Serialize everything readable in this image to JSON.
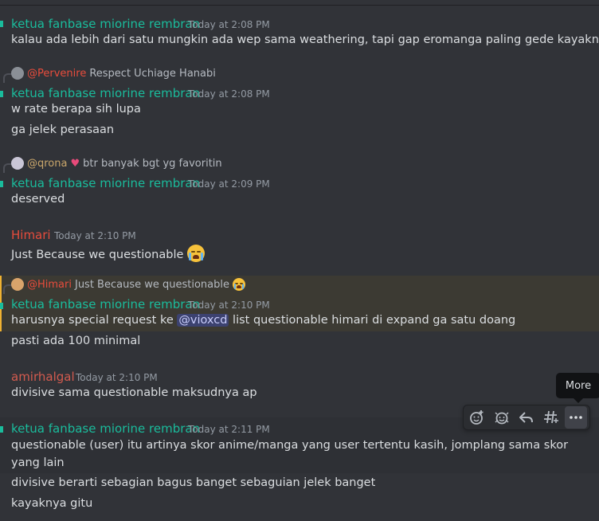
{
  "colors": {
    "background": "#313338",
    "name_teal": "#1abc9c",
    "name_red": "#e74c3c",
    "name_amir": "#d35b4f",
    "mention_highlight": "#3c3a33",
    "mention_bar": "#f0b232",
    "mention_pill": "#3c4270"
  },
  "messages": [
    {
      "author": "ketua fanbase miorine rembran",
      "time": "Today at 2:08 PM",
      "lines": [
        "kalau ada lebih dari satu mungkin ada wep sama weathering, tapi gap eromanga paling gede kayaknya"
      ]
    },
    {
      "reply": {
        "name": "@Pervenire",
        "text": "Respect Uchiage Hanabi"
      },
      "author": "ketua fanbase miorine rembran",
      "time": "Today at 2:08 PM",
      "lines": [
        "w rate berapa sih lupa",
        "ga jelek perasaan"
      ]
    },
    {
      "reply": {
        "name": "@qrona",
        "text": "btr banyak bgt yg favoritin"
      },
      "author": "ketua fanbase miorine rembran",
      "time": "Today at 2:09 PM",
      "lines": [
        "deserved"
      ]
    },
    {
      "author": "Himari",
      "time": "Today at 2:10 PM",
      "lines": [
        "Just Because we questionable"
      ],
      "emoji": "loudly-crying-face"
    },
    {
      "reply": {
        "name": "@Himari",
        "text": "Just Because we questionable"
      },
      "author": "ketua fanbase miorine rembran",
      "time": "Today at 2:10 PM",
      "line_pre": "harusnya special request ke",
      "mention": "@vioxcd",
      "line_post": "list questionable himari di expand ga satu doang",
      "lines": [
        "pasti ada 100 minimal"
      ]
    },
    {
      "author": "amirhalgal",
      "time": "Today at 2:10 PM",
      "lines": [
        "divisive sama questionable maksudnya ap"
      ]
    },
    {
      "author": "ketua fanbase miorine rembran",
      "time": "Today at 2:11 PM",
      "lines": [
        "questionable (user) itu artinya skor anime/manga yang user tertentu kasih, jomplang sama skor yang lain",
        "divisive berarti sebagian bagus banget sebaguian jelek banget",
        "kayaknya gitu"
      ]
    }
  ],
  "toolbar": {
    "buttons": [
      {
        "icon": "add-reaction-icon"
      },
      {
        "icon": "add-super-reaction-icon"
      },
      {
        "icon": "reply-arrow-icon"
      },
      {
        "icon": "create-thread-icon"
      },
      {
        "icon": "more-dots-icon"
      }
    ],
    "tooltip": "More"
  }
}
